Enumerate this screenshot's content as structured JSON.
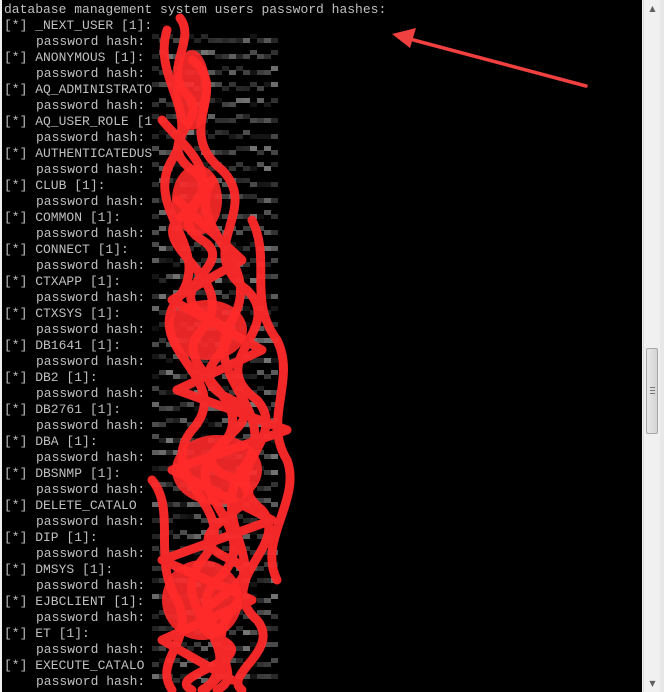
{
  "console": {
    "header": "database management system users password hashes:",
    "hash_label": "password hash:",
    "entries": [
      {
        "user": "[*] _NEXT_USER [1]:"
      },
      {
        "user": "[*] ANONYMOUS [1]:"
      },
      {
        "user": "[*] AQ_ADMINISTRATO"
      },
      {
        "user": "[*] AQ_USER_ROLE [1"
      },
      {
        "user": "[*] AUTHENTICATEDUS"
      },
      {
        "user": "[*] CLUB [1]:"
      },
      {
        "user": "[*] COMMON [1]:"
      },
      {
        "user": "[*] CONNECT [1]:"
      },
      {
        "user": "[*] CTXAPP [1]:"
      },
      {
        "user": "[*] CTXSYS [1]:"
      },
      {
        "user": "[*] DB1641 [1]:"
      },
      {
        "user": "[*] DB2 [1]:"
      },
      {
        "user": "[*] DB2761 [1]:"
      },
      {
        "user": "[*] DBA [1]:"
      },
      {
        "user": "[*] DBSNMP [1]:"
      },
      {
        "user": "[*] DELETE_CATALO"
      },
      {
        "user": "[*] DIP [1]:"
      },
      {
        "user": "[*] DMSYS [1]:"
      },
      {
        "user": "[*] EJBCLIENT [1]:"
      },
      {
        "user": "[*] ET [1]:"
      },
      {
        "user": "[*] EXECUTE_CATALO"
      }
    ]
  },
  "annotation": {
    "arrow_color": "#f04040",
    "scribble_color": "#ff2a2a"
  },
  "scrollbar": {
    "up_icon": "up-arrow-icon",
    "down_icon": "down-arrow-icon",
    "position_fraction": 0.55
  }
}
